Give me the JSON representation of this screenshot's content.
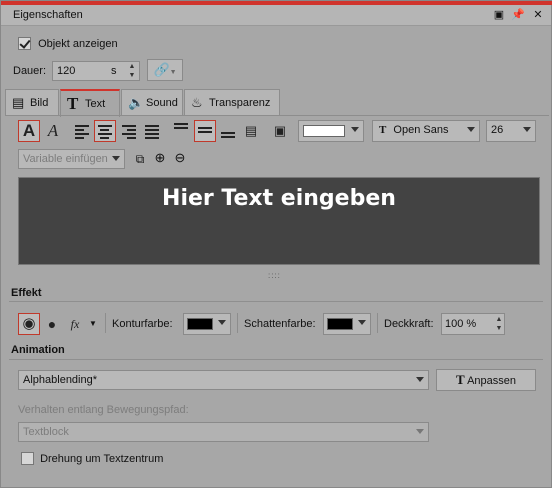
{
  "panel": {
    "title": "Eigenschaften"
  },
  "show_object": {
    "label": "Objekt anzeigen",
    "checked": true
  },
  "duration": {
    "label": "Dauer:",
    "value": "120",
    "unit": "s"
  },
  "tabs": [
    {
      "label": "Bild",
      "icon": "image-icon"
    },
    {
      "label": "Text",
      "icon": "text-t-icon"
    },
    {
      "label": "Sound",
      "icon": "speaker-icon"
    },
    {
      "label": "Transparenz",
      "icon": "transparency-icon"
    }
  ],
  "format": {
    "font": "Open Sans",
    "size": "26",
    "text_color": "#ffffff"
  },
  "variable": {
    "placeholder": "Variable einfügen"
  },
  "preview": {
    "text": "Hier Text eingeben"
  },
  "effect": {
    "section": "Effekt",
    "contour_label": "Konturfarbe:",
    "contour_color": "#000000",
    "shadow_label": "Schattenfarbe:",
    "shadow_color": "#000000",
    "opacity_label": "Deckkraft:",
    "opacity_value": "100 %"
  },
  "animation": {
    "section": "Animation",
    "type": "Alphablending*",
    "adjust_button": "Anpassen",
    "path_label": "Verhalten entlang Bewegungspfad:",
    "path_value": "Textblock",
    "rotate_label": "Drehung um Textzentrum",
    "rotate_checked": false
  },
  "colors": {
    "accent": "#d0342c",
    "background": "#a7a7a7",
    "preview_bg": "#434343"
  }
}
